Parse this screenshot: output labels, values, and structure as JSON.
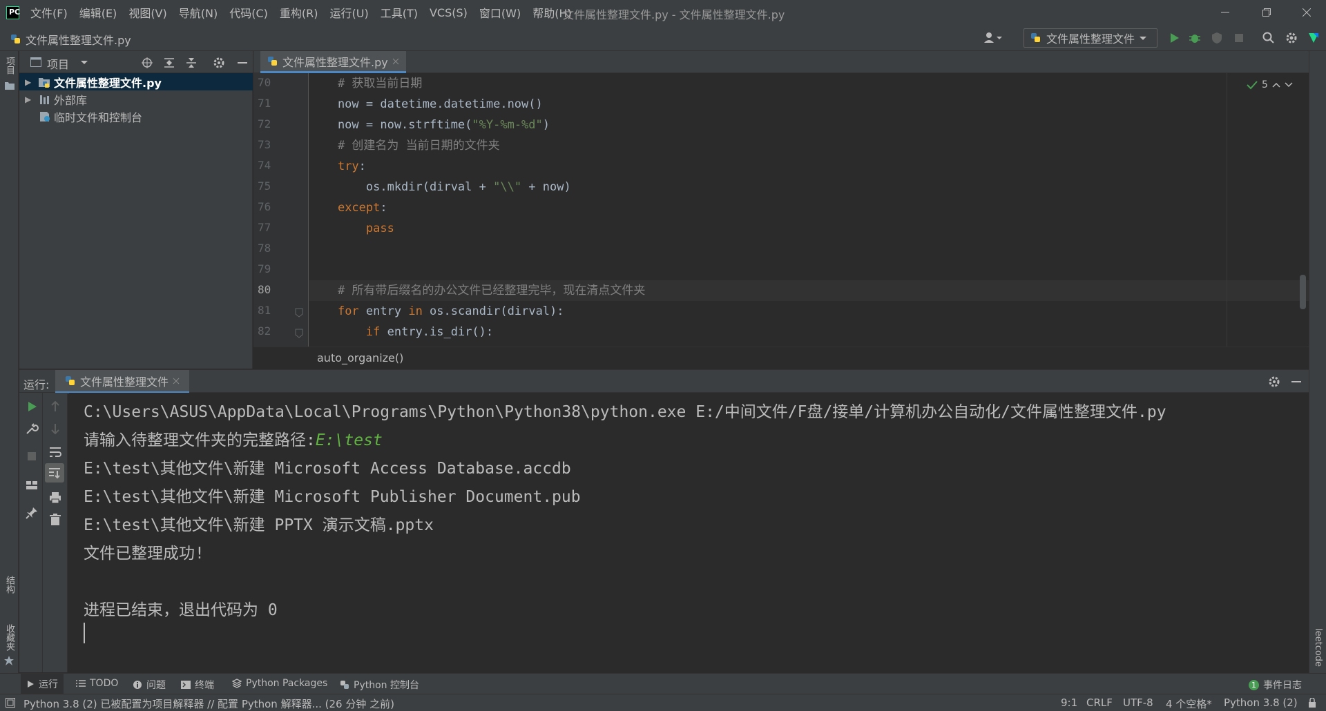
{
  "window": {
    "title": "文件属性整理文件.py - 文件属性整理文件.py",
    "menu": [
      "文件(F)",
      "编辑(E)",
      "视图(V)",
      "导航(N)",
      "代码(C)",
      "重构(R)",
      "运行(U)",
      "工具(T)",
      "VCS(S)",
      "窗口(W)",
      "帮助(H)"
    ]
  },
  "navbar": {
    "file": "文件属性整理文件.py",
    "run_config": "文件属性整理文件"
  },
  "left_strip": {
    "project": "项目",
    "structure": "结构",
    "favorites": "收藏夹"
  },
  "right_strip": {
    "leetcode": "leetcode"
  },
  "project_panel": {
    "title": "项目",
    "tree": [
      {
        "label": "文件属性整理文件.py",
        "selected": true
      },
      {
        "label": "外部库",
        "selected": false
      },
      {
        "label": "临时文件和控制台",
        "selected": false
      }
    ]
  },
  "editor": {
    "tab": "文件属性整理文件.py",
    "inspections": "5",
    "current_line": "80",
    "line_numbers": [
      "70",
      "71",
      "72",
      "73",
      "74",
      "75",
      "76",
      "77",
      "78",
      "79",
      "80",
      "81",
      "82"
    ],
    "breadcrumb": "auto_organize()"
  },
  "run_panel": {
    "label": "运行:",
    "tab": "文件属性整理文件",
    "lines": [
      "C:\\Users\\ASUS\\AppData\\Local\\Programs\\Python\\Python38\\python.exe E:/中间文件/F盘/接单/计算机办公自动化/文件属性整理文件.py",
      "请输入待整理文件夹的完整路径:",
      "E:\\test\\其他文件\\新建 Microsoft Access Database.accdb",
      "E:\\test\\其他文件\\新建 Microsoft Publisher Document.pub",
      "E:\\test\\其他文件\\新建 PPTX 演示文稿.pptx",
      "文件已整理成功!",
      "进程已结束，退出代码为 0"
    ],
    "user_input": "E:\\test"
  },
  "bottom_tabs": {
    "run": "运行",
    "todo": "TODO",
    "problems": "问题",
    "terminal": "终端",
    "packages": "Python Packages",
    "console": "Python 控制台",
    "event_log": "事件日志"
  },
  "status": {
    "message": "Python 3.8 (2) 已被配置为项目解释器 // 配置 Python 解释器... (26 分钟 之前)",
    "position": "9:1",
    "line_sep": "CRLF",
    "encoding": "UTF-8",
    "indent": "4 个空格*",
    "interpreter": "Python 3.8 (2)"
  },
  "colors": {
    "accent": "#4a88c7",
    "keyword": "#cc7832",
    "string": "#6a8759",
    "comment": "#808080",
    "input": "#62b543"
  }
}
